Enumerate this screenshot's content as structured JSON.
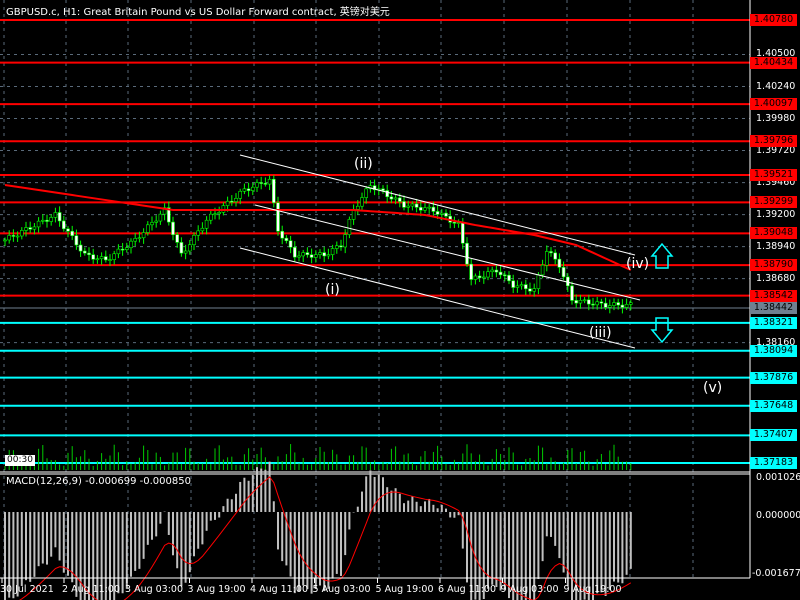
{
  "title": "GBPUSD.c, H1:  Great Britain Pound vs US Dollar Forward contract, 英镑对美元",
  "timer": "00:30",
  "macd_title": "MACD(12,26,9) -0.000699 -0.000850",
  "colors": {
    "red": "#ff0000",
    "cyan": "#00ffff",
    "candle": "#00ff00",
    "bg": "#000000",
    "ma": "#ff0000",
    "hist": "#c0c0c0"
  },
  "price_scale": {
    "top_price": 1.4078,
    "ticks": [
      "1.40500",
      "1.40240",
      "1.39980",
      "1.39720",
      "1.39460",
      "1.39200",
      "1.38940",
      "1.38680",
      "1.38160"
    ]
  },
  "levels_red": [
    "1.40780",
    "1.40434",
    "1.40097",
    "1.39796",
    "1.39521",
    "1.39299",
    "1.39048",
    "1.38790",
    "1.38542"
  ],
  "current_price": "1.38442",
  "levels_cyan": [
    "1.38321",
    "1.38094",
    "1.37876",
    "1.37648",
    "1.37407",
    "1.37183"
  ],
  "macd_scale": [
    "0.001026",
    "0.000000",
    "-0.001677"
  ],
  "time_labels": [
    "30 Jul 2021",
    "2 Aug 11:00",
    "3 Aug 03:00",
    "3 Aug 19:00",
    "4 Aug 11:00",
    "5 Aug 03:00",
    "5 Aug 19:00",
    "6 Aug 11:00",
    "9 Aug 03:00",
    "9 Aug 19:00"
  ],
  "waves": [
    "(i)",
    "(ii)",
    "(iii)",
    "(iv)",
    "(v)"
  ],
  "chart_data": {
    "type": "candlestick",
    "price_anchors": [
      [
        0,
        1.38994
      ],
      [
        12,
        1.39197
      ],
      [
        19,
        1.38872
      ],
      [
        24,
        1.38831
      ],
      [
        31,
        1.38994
      ],
      [
        38,
        1.39237
      ],
      [
        42,
        1.38872
      ],
      [
        48,
        1.39156
      ],
      [
        57,
        1.394
      ],
      [
        63,
        1.39481
      ],
      [
        65,
        1.39075
      ],
      [
        69,
        1.38872
      ],
      [
        76,
        1.38872
      ],
      [
        80,
        1.38953
      ],
      [
        83,
        1.39237
      ],
      [
        87,
        1.3944
      ],
      [
        95,
        1.39278
      ],
      [
        102,
        1.39237
      ],
      [
        108,
        1.39115
      ],
      [
        111,
        1.38669
      ],
      [
        117,
        1.3875
      ],
      [
        121,
        1.38628
      ],
      [
        126,
        1.38588
      ],
      [
        129,
        1.38912
      ],
      [
        132,
        1.38791
      ],
      [
        135,
        1.38506
      ],
      [
        143,
        1.38466
      ],
      [
        149,
        1.38466
      ]
    ],
    "ma_anchors": [
      [
        0,
        1.3944
      ],
      [
        24,
        1.39318
      ],
      [
        40,
        1.39237
      ],
      [
        83,
        1.39237
      ],
      [
        100,
        1.39197
      ],
      [
        112,
        1.39115
      ],
      [
        126,
        1.39034
      ],
      [
        136,
        1.38953
      ],
      [
        149,
        1.3875
      ]
    ]
  }
}
